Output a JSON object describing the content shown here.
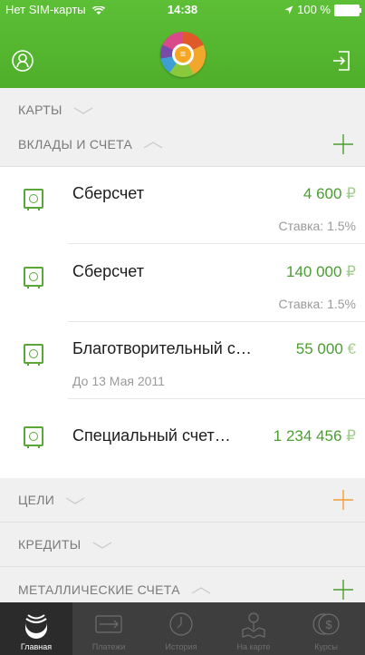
{
  "status_bar": {
    "carrier": "Нет SIM-карты",
    "time": "14:38",
    "battery": "100 %"
  },
  "colors": {
    "header_green": "#5cbf36",
    "amount_green": "#4a9e2f",
    "plus_orange": "#f39c3a",
    "tabbar": "#3e3e3e"
  },
  "sections": {
    "cards": "КАРТЫ",
    "deposits": "ВКЛАДЫ И СЧЕТА",
    "goals": "ЦЕЛИ",
    "credits": "КРЕДИТЫ",
    "metals": "МЕТАЛЛИЧЕСКИЕ СЧЕТА"
  },
  "accounts": [
    {
      "name": "Сберсчет",
      "amount": "4 600",
      "currency": "₽",
      "sub": "Ставка: 1.5%"
    },
    {
      "name": "Сберсчет",
      "amount": "140 000",
      "currency": "₽",
      "sub": "Ставка: 1.5%"
    },
    {
      "name": "Благотворительный с…",
      "amount": "55 000",
      "currency": "€",
      "sub": "До 13 Мая 2011"
    },
    {
      "name": "Специальный счет…",
      "amount": "1 234 456",
      "currency": "₽"
    }
  ],
  "tabs": [
    {
      "label": "Главная",
      "icon": "sber-logo-icon"
    },
    {
      "label": "Платежи",
      "icon": "transfer-card-icon"
    },
    {
      "label": "История",
      "icon": "clock-icon"
    },
    {
      "label": "На карте",
      "icon": "map-pin-icon"
    },
    {
      "label": "Курсы",
      "icon": "dollar-coin-icon"
    }
  ]
}
